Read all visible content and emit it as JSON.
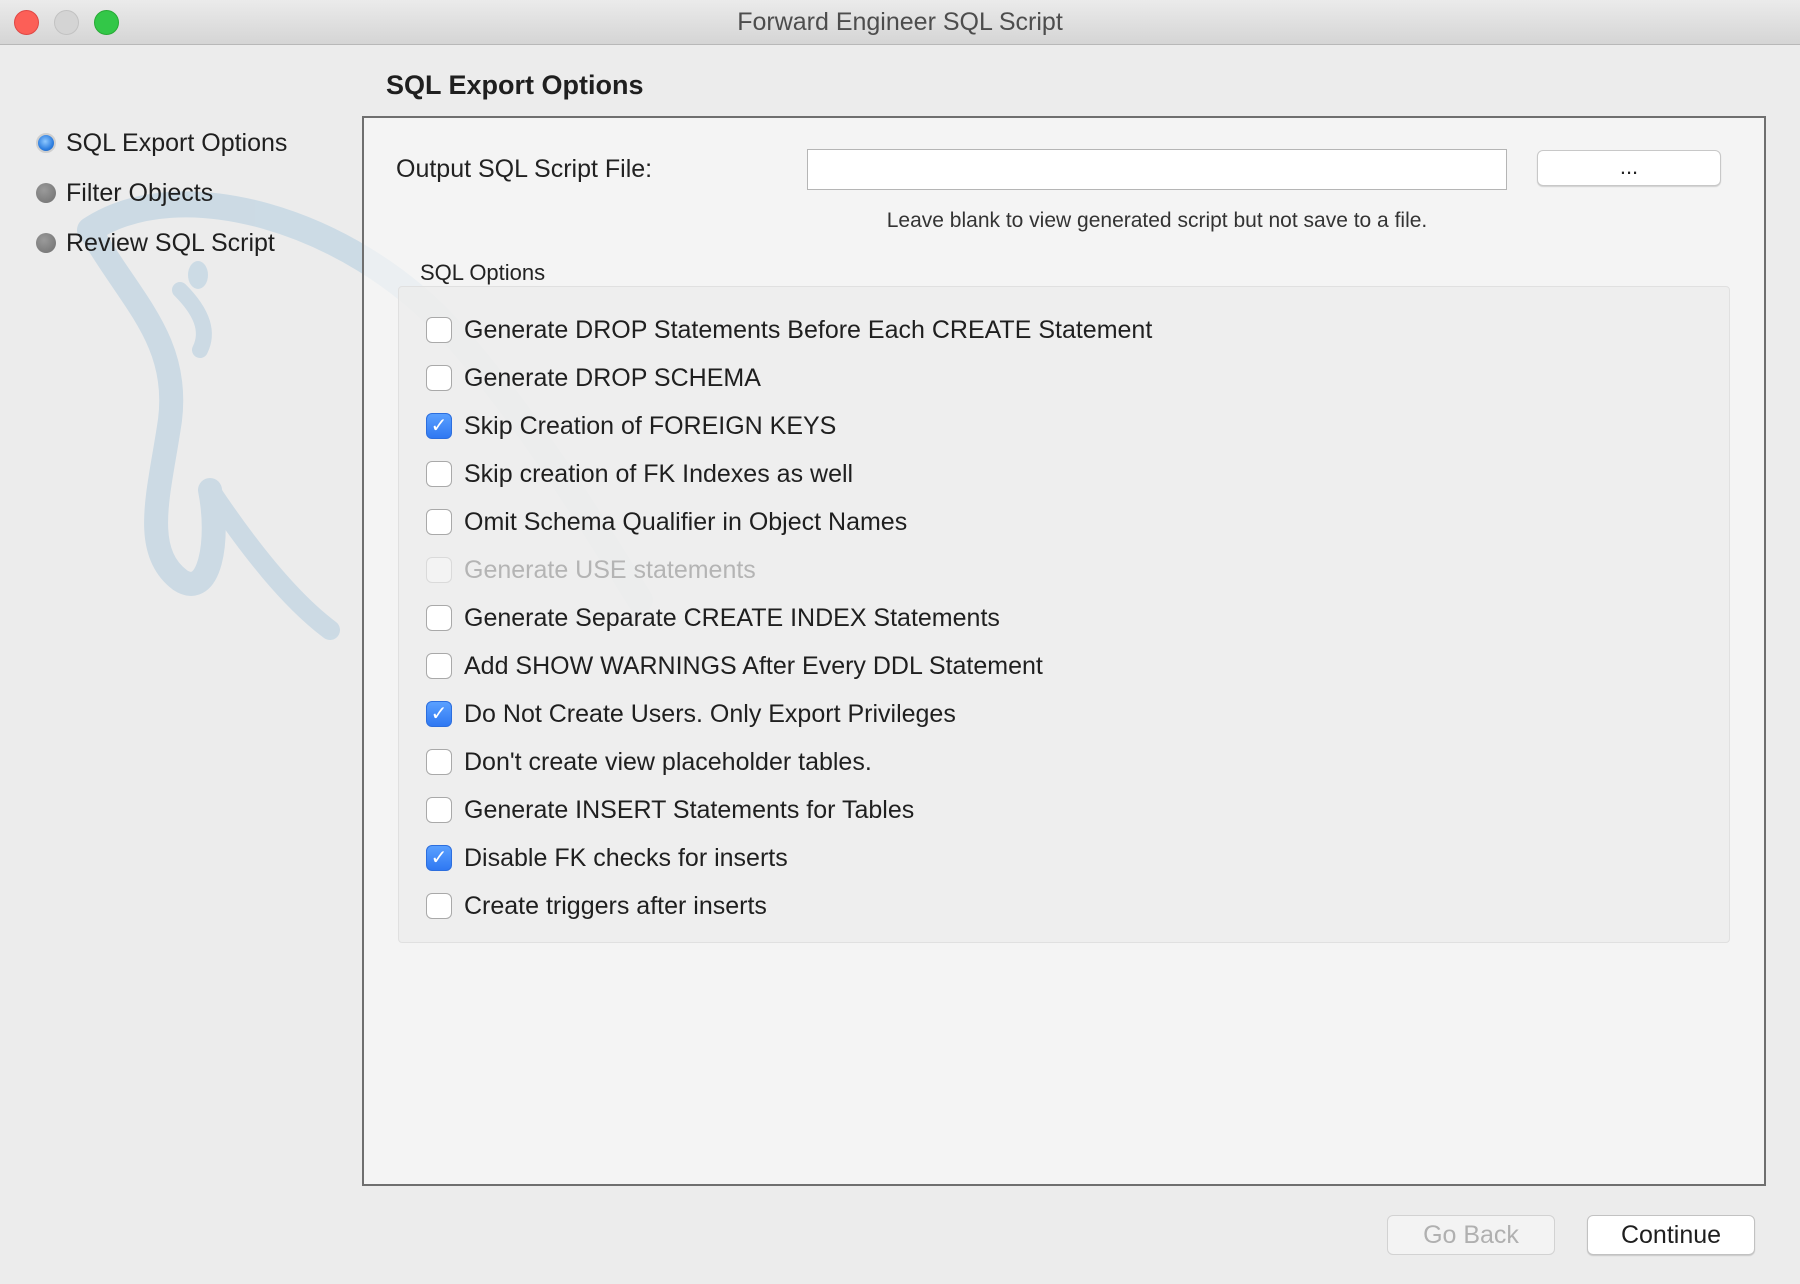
{
  "window": {
    "title": "Forward Engineer SQL Script"
  },
  "steps": [
    {
      "label": "SQL Export Options",
      "active": true
    },
    {
      "label": "Filter Objects",
      "active": false
    },
    {
      "label": "Review SQL Script",
      "active": false
    }
  ],
  "page": {
    "title": "SQL Export Options"
  },
  "output": {
    "label": "Output SQL Script File:",
    "value": "",
    "browse_label": "...",
    "hint": "Leave blank to view generated script but not save to a file."
  },
  "sql_options": {
    "legend": "SQL Options",
    "items": [
      {
        "label": "Generate DROP Statements Before Each CREATE Statement",
        "checked": false,
        "enabled": true
      },
      {
        "label": "Generate DROP SCHEMA",
        "checked": false,
        "enabled": true
      },
      {
        "label": "Skip Creation of FOREIGN KEYS",
        "checked": true,
        "enabled": true
      },
      {
        "label": "Skip creation of FK Indexes as well",
        "checked": false,
        "enabled": true
      },
      {
        "label": "Omit Schema Qualifier in Object Names",
        "checked": false,
        "enabled": true
      },
      {
        "label": "Generate USE statements",
        "checked": false,
        "enabled": false
      },
      {
        "label": "Generate Separate CREATE INDEX Statements",
        "checked": false,
        "enabled": true
      },
      {
        "label": "Add SHOW WARNINGS After Every DDL Statement",
        "checked": false,
        "enabled": true
      },
      {
        "label": "Do Not Create Users. Only Export Privileges",
        "checked": true,
        "enabled": true
      },
      {
        "label": "Don't create view placeholder tables.",
        "checked": false,
        "enabled": true
      },
      {
        "label": "Generate INSERT Statements for Tables",
        "checked": false,
        "enabled": true
      },
      {
        "label": "Disable FK checks for inserts",
        "checked": true,
        "enabled": true
      },
      {
        "label": "Create triggers after inserts",
        "checked": false,
        "enabled": true
      }
    ]
  },
  "footer": {
    "back_label": "Go Back",
    "back_enabled": false,
    "continue_label": "Continue"
  },
  "colors": {
    "accent": "#2f78f2",
    "close": "#fc5f57",
    "zoom": "#33c748"
  }
}
